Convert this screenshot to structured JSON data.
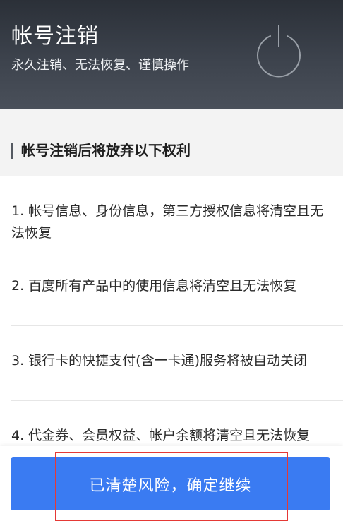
{
  "header": {
    "title": "帐号注销",
    "subtitle": "永久注销、无法恢复、谨慎操作",
    "icon": "power-icon"
  },
  "section": {
    "title": "帐号注销后将放弃以下权利"
  },
  "rights": [
    {
      "text": "1. 帐号信息、身份信息，第三方授权信息将清空且无法恢复"
    },
    {
      "text": "2. 百度所有产品中的使用信息将清空且无法恢复"
    },
    {
      "text": "3. 银行卡的快捷支付(含一卡通)服务将被自动关闭"
    },
    {
      "text": "4. 代金券、会员权益、帐户余额将清空且无法恢复"
    }
  ],
  "confirm_button": {
    "label": "已清楚风险，确定继续",
    "color": "#3a7bf2"
  },
  "colors": {
    "header_bg": "#2b3038",
    "highlight": "#e53935"
  }
}
